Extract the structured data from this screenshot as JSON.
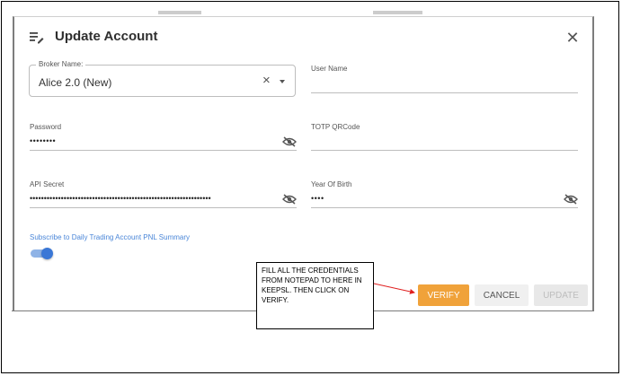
{
  "modal": {
    "title": "Update Account",
    "close_icon": "close-icon",
    "header_icon": "edit-list-icon"
  },
  "form": {
    "broker": {
      "label": "Broker Name:",
      "value": "Alice 2.0 (New)",
      "clear_icon": "clear-icon",
      "caret_icon": "chevron-down-icon"
    },
    "user_name": {
      "label": "User Name",
      "value": ""
    },
    "password": {
      "label": "Password",
      "value": "••••••••",
      "icon": "eye-off-icon"
    },
    "totp": {
      "label": "TOTP QRCode",
      "value": ""
    },
    "api_secret": {
      "label": "API Secret",
      "value": "••••••••••••••••••••••••••••••••••••••••••••••••••••••••••••••••",
      "icon": "eye-off-icon"
    },
    "year_of_birth": {
      "label": "Year Of Birth",
      "value": "••••",
      "icon": "eye-off-icon"
    },
    "subscribe": {
      "label": "Subscribe to Daily Trading Account PNL Summary",
      "enabled": true
    }
  },
  "buttons": {
    "verify": "VERIFY",
    "cancel": "CANCEL",
    "update": "UPDATE"
  },
  "colors": {
    "accent": "#f0a23a",
    "link": "#4a86d8",
    "toggle": "#3a77d6",
    "arrow": "#e02020"
  },
  "annotation": {
    "text": "FILL ALL THE CREDENTIALS FROM NOTEPAD TO HERE IN KEEPSL. THEN CLICK ON VERIFY."
  }
}
